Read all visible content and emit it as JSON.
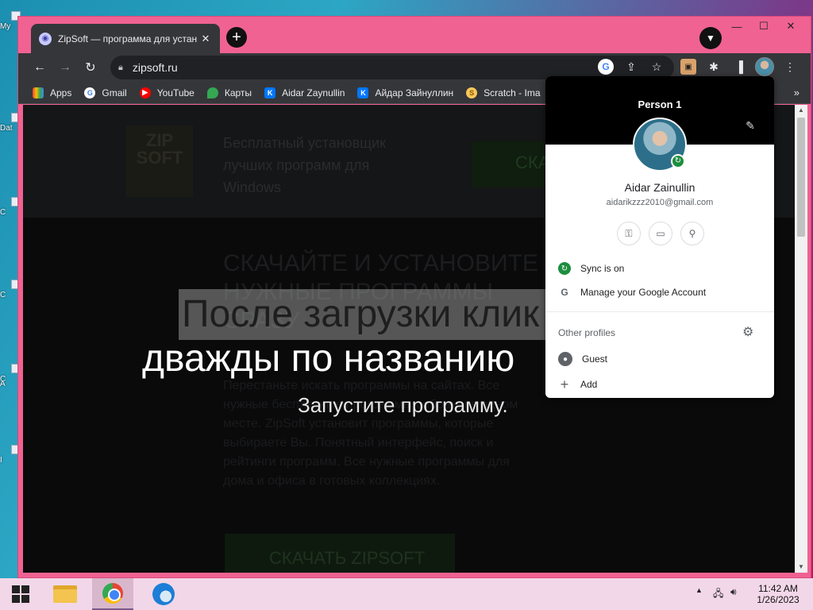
{
  "desktop": {
    "icons": [
      "My",
      "Dat",
      "C",
      "C",
      "C",
      "A",
      "I"
    ]
  },
  "browser": {
    "tab_title": "ZipSoft — программа для устан",
    "tab_close": "✕",
    "new_tab": "+",
    "window_controls": {
      "minimize": "—",
      "maximize": "☐",
      "close": "✕"
    },
    "url": "zipsoft.ru",
    "bookmarks": [
      {
        "label": "Apps",
        "icon": "apps-grid-icon"
      },
      {
        "label": "Gmail",
        "icon": "google-icon"
      },
      {
        "label": "YouTube",
        "icon": "youtube-icon"
      },
      {
        "label": "Карты",
        "icon": "maps-icon"
      },
      {
        "label": "Aidar Zaynullin",
        "icon": "vk-icon"
      },
      {
        "label": "Айдар Зайнуллин",
        "icon": "vk-icon"
      },
      {
        "label": "Scratch - Ima",
        "icon": "scratch-icon"
      }
    ],
    "bookmarks_more": "»"
  },
  "page": {
    "logo": "ZIP SOFT",
    "tagline": "Бесплатный установщик лучших программ для Windows",
    "header_download": "СКА",
    "hero_heading": "СКАЧАЙТЕ И УСТАНОВИТЕ НУЖНЫЕ ПРОГРАММЫ СРАЗУ",
    "hero_text": "Перестаньте искать программы на сайтах. Все нужные бесплатные программы собраны в одном месте. ZipSoft установит программы, которые выбираете Вы. Понятный интерфейс, поиск и рейтинги программ. Все нужные программы для дома и офиса в готовых коллекциях.",
    "hero_button": "СКАЧАТЬ ZIPSOFT"
  },
  "captions": {
    "line1": "После загрузки клик",
    "line2": "дважды по названию",
    "line3": "Запустите программу."
  },
  "profile": {
    "header_name": "Person 1",
    "full_name": "Aidar Zainullin",
    "email": "aidarikzzz2010@gmail.com",
    "sync": "Sync is on",
    "manage": "Manage your Google Account",
    "other_profiles": "Other profiles",
    "guest": "Guest",
    "add": "Add"
  },
  "taskbar": {
    "time": "11:42 AM",
    "date": "1/26/2023"
  },
  "colors": {
    "window_border": "#f06292",
    "toolbar": "#35363a",
    "sync_green": "#1e8e3e"
  }
}
